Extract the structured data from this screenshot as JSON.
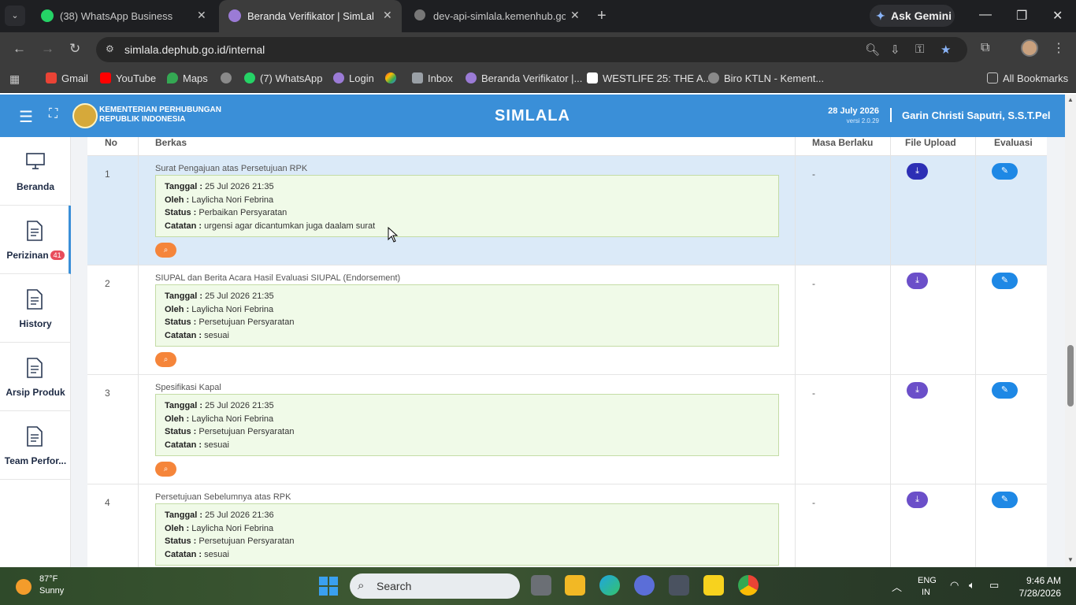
{
  "browser": {
    "tabs": [
      {
        "title": "(38) WhatsApp Business",
        "badge": "38"
      },
      {
        "title": "Beranda Verifikator | SimLala"
      },
      {
        "title": "dev-api-simlala.kemenhub.go.id"
      }
    ],
    "ask_gemini": "Ask Gemini",
    "url": "simlala.dephub.go.id/internal",
    "bookmarks": [
      "Gmail",
      "YouTube",
      "Maps",
      "(7) WhatsApp",
      "Login",
      "Inbox",
      "Beranda Verifikator |...",
      "WESTLIFE 25: THE A...",
      "Biro KTLN - Kement..."
    ],
    "whatsapp_badge": "38",
    "all_bookmarks": "All Bookmarks"
  },
  "header": {
    "org_line1": "KEMENTERIAN PERHUBUNGAN",
    "org_line2": "REPUBLIK INDONESIA",
    "app_title": "SIMLALA",
    "date": "28 July 2026",
    "version": "versi 2.0.29",
    "user": "Garin Christi Saputri, S.S.T.Pel"
  },
  "sidebar": {
    "items": [
      {
        "label": "Beranda",
        "icon": "monitor-icon"
      },
      {
        "label": "Perizinan",
        "icon": "document-icon",
        "badge": "41"
      },
      {
        "label": "History",
        "icon": "document-icon"
      },
      {
        "label": "Arsip Produk",
        "icon": "document-icon"
      },
      {
        "label": "Team Perfor...",
        "icon": "document-icon"
      }
    ]
  },
  "table": {
    "headers": {
      "no": "No",
      "berkas": "Berkas",
      "masa": "Masa Berlaku",
      "upload": "File Upload",
      "evaluasi": "Evaluasi"
    },
    "labels": {
      "tanggal": "Tanggal :",
      "oleh": "Oleh :",
      "status": "Status :",
      "catatan": "Catatan :"
    },
    "rows": [
      {
        "no": "1",
        "berkas": "Surat Pengajuan atas Persetujuan RPK",
        "tanggal": "25 Jul 2026 21:35",
        "oleh": "Laylicha Nori Febrina",
        "status": "Perbaikan Persyaratan",
        "catatan": "urgensi agar dicantumkan juga daalam surat",
        "masa": "-"
      },
      {
        "no": "2",
        "berkas": "SIUPAL dan Berita Acara Hasil Evaluasi SIUPAL (Endorsement)",
        "tanggal": "25 Jul 2026 21:35",
        "oleh": "Laylicha Nori Febrina",
        "status": "Persetujuan Persyaratan",
        "catatan": "sesuai",
        "masa": "-"
      },
      {
        "no": "3",
        "berkas": "Spesifikasi Kapal",
        "tanggal": "25 Jul 2026 21:35",
        "oleh": "Laylicha Nori Febrina",
        "status": "Persetujuan Persyaratan",
        "catatan": "sesuai",
        "masa": "-"
      },
      {
        "no": "4",
        "berkas": "Persetujuan Sebelumnya atas RPK",
        "tanggal": "25 Jul 2026 21:36",
        "oleh": "Laylicha Nori Febrina",
        "status": "Persetujuan Persyaratan",
        "catatan": "sesuai",
        "masa": "-"
      }
    ]
  },
  "taskbar": {
    "temp": "87°F",
    "condition": "Sunny",
    "search": "Search",
    "lang1": "ENG",
    "lang2": "IN",
    "time": "9:46 AM",
    "date": "7/28/2026"
  },
  "colors": {
    "header_blue": "#3a8fd8",
    "row_highlight": "#dbeaf8",
    "note_bg": "#f0fae8",
    "search_btn": "#f5853a",
    "eval_btn": "#1e88e5"
  }
}
